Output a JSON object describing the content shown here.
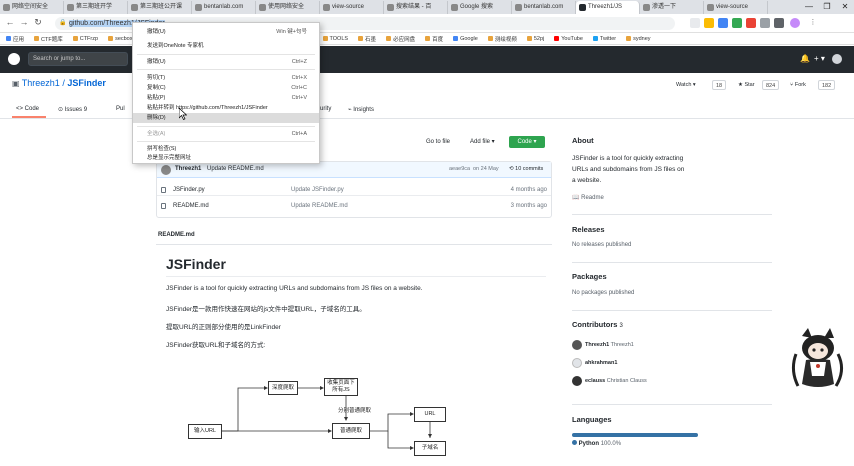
{
  "browser": {
    "tabs": [
      {
        "label": "网络空间安全"
      },
      {
        "label": "第三期班开学"
      },
      {
        "label": "第三期班公开课"
      },
      {
        "label": "bentanlab.com"
      },
      {
        "label": "使用网络安全"
      },
      {
        "label": "view-source"
      },
      {
        "label": "搜索结果 - 百"
      },
      {
        "label": "Google 搜索"
      },
      {
        "label": "bentanlab.com"
      },
      {
        "label": "Threezh1/JS",
        "active": true
      },
      {
        "label": "渗透一下"
      },
      {
        "label": "view-source"
      }
    ],
    "url": "github.com/Threezh1/JSFinder",
    "window_controls": [
      "—",
      "❐",
      "✕"
    ]
  },
  "bookmarks": [
    "应用",
    "CTF题库",
    "CTFrzp",
    "secbox",
    "TOOLS",
    "石墨",
    "必应网盘",
    "百度",
    "Google",
    "测绘视频",
    "52pj",
    "YouTube",
    "Twitter",
    "sydney"
  ],
  "github": {
    "search_placeholder": "Search or jump to...",
    "plus": "+ ▾"
  },
  "repo": {
    "owner": "Threezh1",
    "separator": " / ",
    "name": "JSFinder",
    "watch_label": "Watch ▾",
    "watch_count": "18",
    "star_label": "★ Star",
    "star_count": "824",
    "fork_label": "Fork",
    "fork_count": "182",
    "tabs": {
      "code": "<> Code",
      "issues": "Issues",
      "issues_count": "9",
      "pull": "Pul",
      "security": "urity",
      "insights": "Insights"
    }
  },
  "context_menu": {
    "items": [
      {
        "label": "撤销(U)",
        "shortcut": "Win 键+句号"
      },
      {
        "label": "发送到OneNote 专家机",
        "shortcut": ""
      },
      {
        "label": "撤销(U)",
        "shortcut": "Ctrl+Z"
      },
      {
        "label": "剪切(T)",
        "shortcut": "Ctrl+X"
      },
      {
        "label": "复制(C)",
        "shortcut": "Ctrl+C"
      },
      {
        "label": "粘贴(P)",
        "shortcut": "Ctrl+V"
      },
      {
        "label": "粘贴并转到 https://github.com/Threezh1/JSFinder",
        "shortcut": ""
      },
      {
        "label": "删除(D)",
        "shortcut": ""
      },
      {
        "label": "全选(A)",
        "shortcut": "Ctrl+A"
      },
      {
        "label": "拼写检查(S)",
        "shortcut": ""
      },
      {
        "label": "总是显示完整网址",
        "shortcut": ""
      }
    ]
  },
  "actions": {
    "go_to_file": "Go to file",
    "add_file": "Add file ▾",
    "code": "Code ▾"
  },
  "commit": {
    "author": "Threezh1",
    "message": "Update README.md",
    "hash": "aeae9ca",
    "date": "on 24 May",
    "commits": "10 commits"
  },
  "files": [
    {
      "name": "JSFinder.py",
      "message": "Update JSFinder.py",
      "age": "4 months ago"
    },
    {
      "name": "README.md",
      "message": "Update README.md",
      "age": "3 months ago"
    }
  ],
  "readme": {
    "header": "README.md",
    "title": "JSFinder",
    "p1": "JSFinder is a tool for quickly extracting URLs and subdomains from JS files on a website.",
    "p2": "JSFinder是一款用作快速在网站的js文件中提取URL，子域名的工具。",
    "p3": "提取URL的正则部分使用的是LinkFinder",
    "p4": "JSFinder获取URL和子域名的方式:"
  },
  "diagram": {
    "deep": "深度爬取",
    "collect": "收集页面下所有JS",
    "split": "分别普通爬取",
    "url": "URL",
    "input": "输入URL",
    "normal": "普通爬取",
    "subdomain": "子域名"
  },
  "sidebar": {
    "about_h": "About",
    "about_1": "JSFinder is a tool for quickly extracting",
    "about_2": "URLs and subdomains from JS files on",
    "about_3": "a website.",
    "readme_link": "Readme",
    "releases_h": "Releases",
    "releases_t": "No releases published",
    "packages_h": "Packages",
    "packages_t": "No packages published",
    "contributors_h": "Contributors",
    "contributors_count": "3",
    "contributors": [
      {
        "user": "Threezh1",
        "name": "Threezh1"
      },
      {
        "user": "ahkrahman1",
        "name": ""
      },
      {
        "user": "eclauss",
        "name": "Christian Clauss"
      }
    ],
    "languages_h": "Languages",
    "lang": "Python",
    "lang_pct": "100.0%"
  },
  "colors": {
    "github_dark": "#24292e",
    "link": "#0366d6",
    "green": "#2ea44f",
    "python": "#3572a5"
  }
}
